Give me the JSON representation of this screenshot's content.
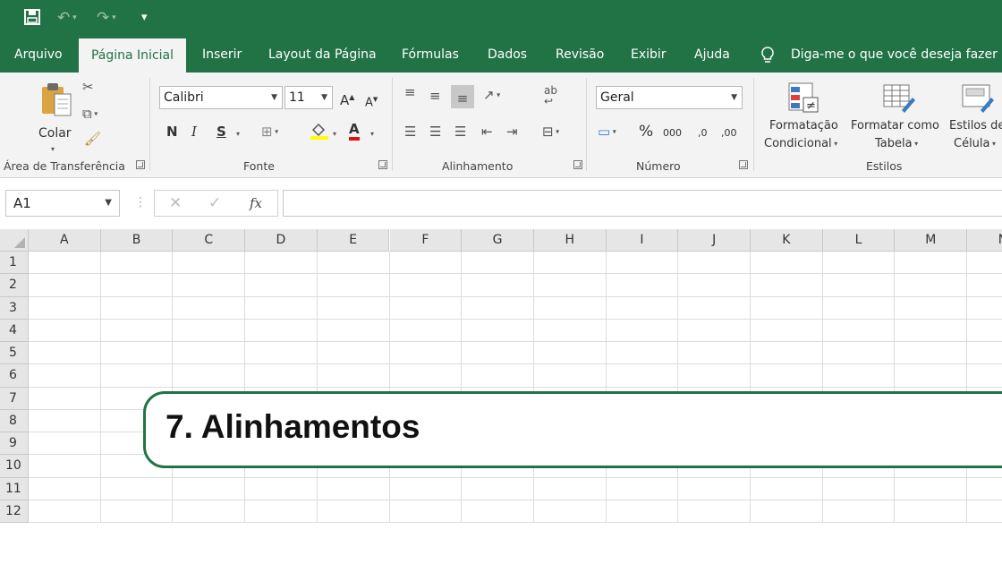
{
  "quick_access": {
    "icons": [
      "save-icon",
      "undo-icon",
      "redo-icon",
      "customize-icon"
    ],
    "colors": {
      "brand": "#217346",
      "ribbon_bg": "#f3f3f3"
    }
  },
  "tabs": [
    {
      "label": "Arquivo",
      "active": false
    },
    {
      "label": "Página Inicial",
      "active": true
    },
    {
      "label": "Inserir",
      "active": false
    },
    {
      "label": "Layout da Página",
      "active": false
    },
    {
      "label": "Fórmulas",
      "active": false
    },
    {
      "label": "Dados",
      "active": false
    },
    {
      "label": "Revisão",
      "active": false
    },
    {
      "label": "Exibir",
      "active": false
    },
    {
      "label": "Ajuda",
      "active": false
    }
  ],
  "tell_me": "Diga-me o que você deseja fazer",
  "ribbon": {
    "clipboard": {
      "label": "Área de Transferência",
      "paste": "Colar"
    },
    "font": {
      "label": "Fonte",
      "font_name": "Calibri",
      "font_size": "11",
      "bold": "N",
      "italic": "I",
      "underline": "S",
      "grow": "A",
      "shrink": "A",
      "font_color": "A"
    },
    "alignment": {
      "label": "Alinhamento",
      "wrap": "ab"
    },
    "number": {
      "label": "Número",
      "format": "Geral",
      "percent": "%",
      "thousands": "000",
      "inc_dec": ",0",
      "dec_dec": ",00"
    },
    "styles": {
      "label": "Estilos",
      "conditional_1": "Formatação",
      "conditional_2": "Condicional",
      "table_1": "Formatar como",
      "table_2": "Tabela",
      "cell_1": "Estilos de",
      "cell_2": "Célula"
    }
  },
  "formula_bar": {
    "name_box": "A1",
    "fx": "fx",
    "value": ""
  },
  "sheet": {
    "columns": [
      "A",
      "B",
      "C",
      "D",
      "E",
      "F",
      "G",
      "H",
      "I",
      "J",
      "K",
      "L",
      "M",
      "N"
    ],
    "rows": [
      "1",
      "2",
      "3",
      "4",
      "5",
      "6",
      "7",
      "8",
      "9",
      "10",
      "11",
      "12"
    ]
  },
  "overlay": {
    "title": "7. Alinhamentos"
  }
}
